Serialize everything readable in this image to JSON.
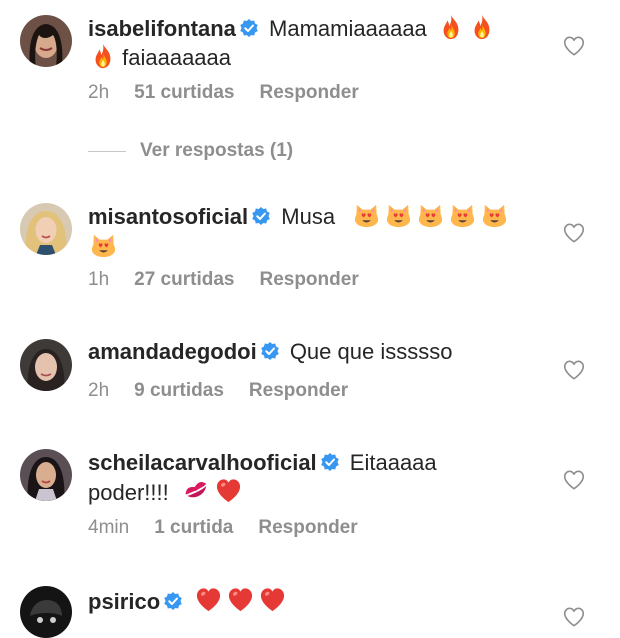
{
  "comments": [
    {
      "username": "isabelifontana",
      "text_before": "Mamamiaaaaaa",
      "text_after": "faiaaaaaaa",
      "emojis": [
        "fire",
        "fire",
        "fire"
      ],
      "time": "2h",
      "likes": "51 curtidas",
      "reply": "Responder"
    },
    {
      "username": "misantosoficial",
      "text": "Musa",
      "emojis": [
        "heart-eyes-cat",
        "heart-eyes-cat",
        "heart-eyes-cat",
        "heart-eyes-cat",
        "heart-eyes-cat",
        "heart-eyes-cat"
      ],
      "time": "1h",
      "likes": "27 curtidas",
      "reply": "Responder"
    },
    {
      "username": "amandadegodoi",
      "text": "Que que issssso",
      "time": "2h",
      "likes": "9 curtidas",
      "reply": "Responder"
    },
    {
      "username": "scheilacarvalhooficial",
      "text_before": "Eitaaaaa",
      "text_after": "poder!!!!",
      "emojis": [
        "kiss-mark",
        "red-heart"
      ],
      "time": "4min",
      "likes": "1 curtida",
      "reply": "Responder"
    },
    {
      "username": "psirico",
      "emojis": [
        "red-heart",
        "red-heart",
        "red-heart"
      ]
    }
  ],
  "view_replies": "Ver respostas (1)",
  "colors": {
    "text": "#262626",
    "muted": "#8e8e8e",
    "verified": "#3897f0"
  }
}
